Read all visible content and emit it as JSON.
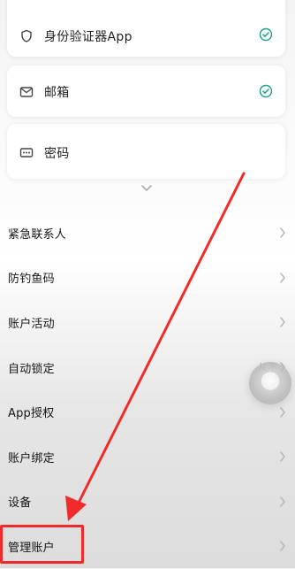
{
  "header": {
    "back_icon": "arrow-left-icon"
  },
  "security_cards": [
    {
      "label": "身份验证器App",
      "icon": "shield-icon",
      "status": "verified",
      "status_icon": "check-circle-icon"
    },
    {
      "label": "邮箱",
      "icon": "mail-icon",
      "status": "verified",
      "status_icon": "check-circle-icon"
    },
    {
      "label": "密码",
      "icon": "password-card-icon"
    }
  ],
  "expand_icon": "chevron-down-icon",
  "menu": [
    {
      "label": "紧急联系人",
      "value": ""
    },
    {
      "label": "防钓鱼码",
      "value": ""
    },
    {
      "label": "账户活动",
      "value": ""
    },
    {
      "label": "自动锁定",
      "value": "从不"
    },
    {
      "label": "App授权",
      "value": ""
    },
    {
      "label": "账户绑定",
      "value": ""
    },
    {
      "label": "设备",
      "value": ""
    },
    {
      "label": "管理账户",
      "value": ""
    }
  ],
  "colors": {
    "accent": "#1aa38c",
    "annotation": "#f12b2b",
    "text": "#151515",
    "muted": "#9a9a9a"
  }
}
